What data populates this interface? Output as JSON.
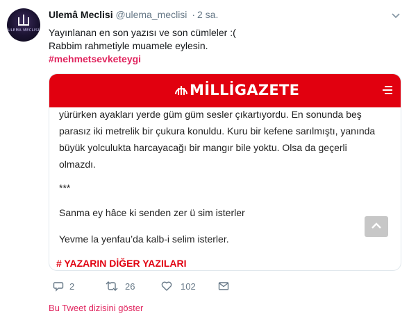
{
  "tweet": {
    "author_name": "Ulemâ Meclisi",
    "handle": "@ulema_meclisi",
    "separator": "·",
    "time": "2 sa.",
    "avatar_text": "ULEMA MECLISI",
    "lines": [
      "Yayınlanan en son yazısı ve son cümleler :(",
      "Rabbim rahmetiyle muamele eylesin."
    ],
    "hashtag": "#mehmetsevketeygi"
  },
  "card": {
    "brand": "MİLLİGAZETE",
    "paragraphs": [
      "yürürken ayakları yerde güm güm sesler çıkartıyordu. En sonunda beş parasız iki metrelik bir çukura konuldu. Kuru bir kefene sarılmıştı, yanında büyük yolculukta harcayacağı bir mangır bile yoktu. Olsa da geçerli olmazdı.",
      "***",
      "Sanma ey hâce ki senden zer ü sim isterler",
      "Yevme la yenfau’da kalb-i selim isterler."
    ],
    "more_link": "# YAZARIN DİĞER YAZILARI"
  },
  "actions": {
    "reply_count": "2",
    "retweet_count": "26",
    "like_count": "102"
  },
  "thread_link": "Bu Tweet dizisini göster",
  "colors": {
    "brand_red": "#e1000f",
    "hashtag": "#e0245e",
    "muted": "#657786"
  }
}
